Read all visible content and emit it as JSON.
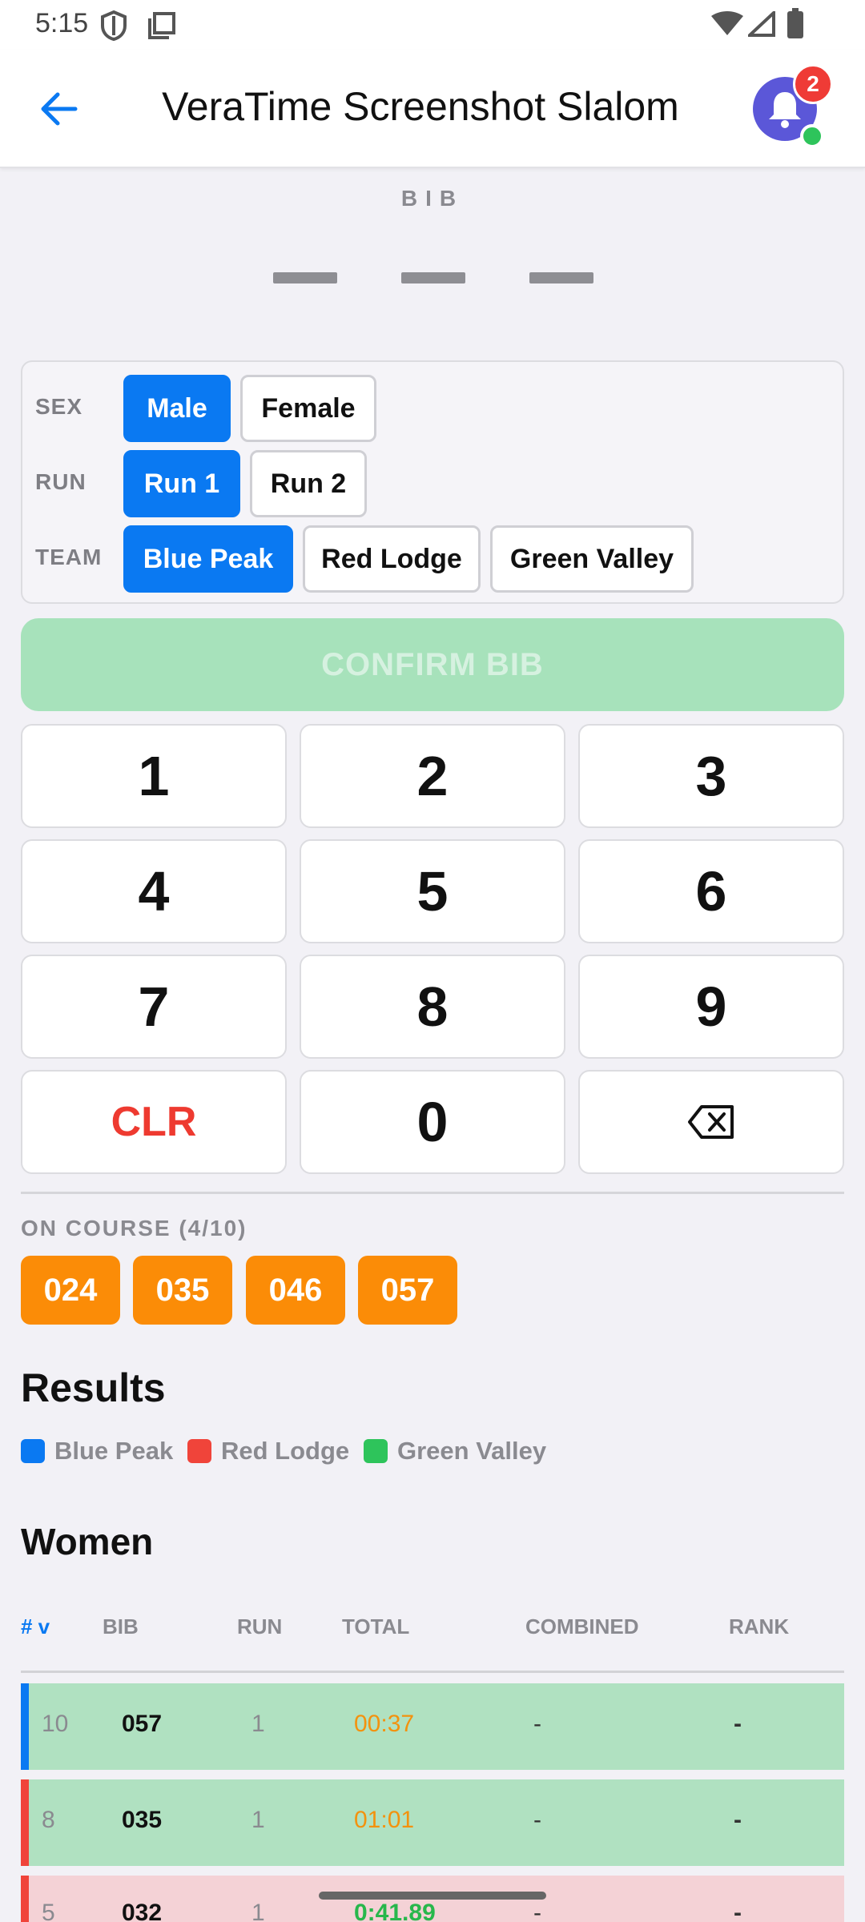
{
  "status_bar": {
    "time": "5:15"
  },
  "app_bar": {
    "title": "VeraTime Screenshot Slalom",
    "notification_count": "2"
  },
  "bib": {
    "label": "BIB"
  },
  "options": {
    "sex": {
      "label": "SEX",
      "chips": [
        "Male",
        "Female"
      ],
      "selected": "Male"
    },
    "run": {
      "label": "RUN",
      "chips": [
        "Run 1",
        "Run 2"
      ],
      "selected": "Run 1"
    },
    "team": {
      "label": "TEAM",
      "chips": [
        "Blue Peak",
        "Red Lodge",
        "Green Valley"
      ],
      "selected": "Blue Peak"
    }
  },
  "confirm_label": "CONFIRM BIB",
  "keypad": [
    "1",
    "2",
    "3",
    "4",
    "5",
    "6",
    "7",
    "8",
    "9",
    "CLR",
    "0"
  ],
  "on_course": {
    "label": "ON COURSE (4/10)",
    "bibs": [
      "024",
      "035",
      "046",
      "057"
    ]
  },
  "results": {
    "title": "Results",
    "legend": [
      {
        "name": "Blue Peak",
        "color": "#0a79f2"
      },
      {
        "name": "Red Lodge",
        "color": "#f0443a"
      },
      {
        "name": "Green Valley",
        "color": "#2ec45b"
      }
    ]
  },
  "women": {
    "title": "Women",
    "columns": [
      "# v",
      "BIB",
      "RUN",
      "TOTAL",
      "COMBINED",
      "RANK"
    ],
    "rows": [
      {
        "num": "10",
        "bib": "057",
        "run": "1",
        "total": "00:37",
        "combined": "-",
        "rank": "-"
      },
      {
        "num": "8",
        "bib": "035",
        "run": "1",
        "total": "01:01",
        "combined": "-",
        "rank": "-"
      },
      {
        "num": "5",
        "bib": "032",
        "run": "1",
        "total": "0:41.89",
        "combined": "-",
        "rank": "-"
      }
    ]
  },
  "colors": {
    "accent": "#0a79f2",
    "on_course": "#fb8c07",
    "row_green": "#b0e1c1",
    "row_red": "#f4d2d6"
  }
}
